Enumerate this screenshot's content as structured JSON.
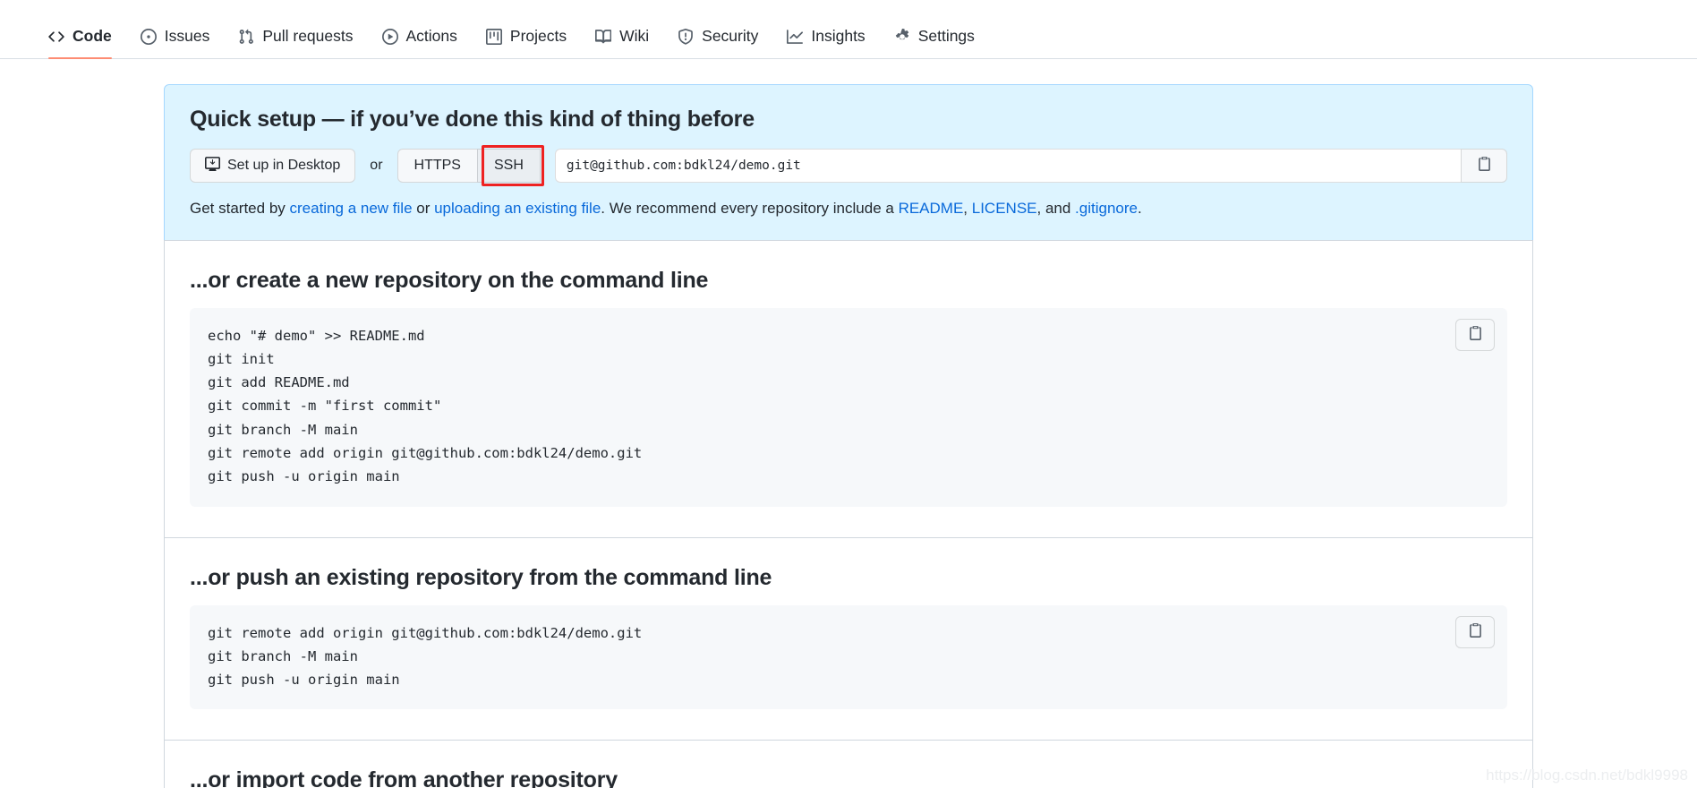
{
  "nav": {
    "items": [
      {
        "label": "Code",
        "icon": "code-icon",
        "active": true
      },
      {
        "label": "Issues",
        "icon": "issue-opened-icon",
        "active": false
      },
      {
        "label": "Pull requests",
        "icon": "git-pull-request-icon",
        "active": false
      },
      {
        "label": "Actions",
        "icon": "play-icon",
        "active": false
      },
      {
        "label": "Projects",
        "icon": "project-icon",
        "active": false
      },
      {
        "label": "Wiki",
        "icon": "book-icon",
        "active": false
      },
      {
        "label": "Security",
        "icon": "shield-icon",
        "active": false
      },
      {
        "label": "Insights",
        "icon": "graph-icon",
        "active": false
      },
      {
        "label": "Settings",
        "icon": "gear-icon",
        "active": false
      }
    ],
    "active_underline_color": "#fd8c73"
  },
  "quick_setup": {
    "title": "Quick setup — if you’ve done this kind of thing before",
    "desktop_button": "Set up in Desktop",
    "or_label": "or",
    "protocol": {
      "https_label": "HTTPS",
      "ssh_label": "SSH",
      "selected": "SSH",
      "highlight_color": "#ee2222"
    },
    "clone_url": "git@github.com:bdkl24/demo.git",
    "copy_icon": "clipboard-icon",
    "get_started": {
      "prefix": "Get started by ",
      "link_create": "creating a new file",
      "mid1": " or ",
      "link_upload": "uploading an existing file",
      "mid2": ". We recommend every repository include a ",
      "link_readme": "README",
      "comma1": ", ",
      "link_license": "LICENSE",
      "mid3": ", and ",
      "link_gitignore": ".gitignore",
      "suffix": "."
    },
    "background_color": "#ddf4ff"
  },
  "sections": [
    {
      "title": "...or create a new repository on the command line",
      "copy_icon": "clipboard-icon",
      "code": "echo \"# demo\" >> README.md\ngit init\ngit add README.md\ngit commit -m \"first commit\"\ngit branch -M main\ngit remote add origin git@github.com:bdkl24/demo.git\ngit push -u origin main"
    },
    {
      "title": "...or push an existing repository from the command line",
      "copy_icon": "clipboard-icon",
      "code": "git remote add origin git@github.com:bdkl24/demo.git\ngit branch -M main\ngit push -u origin main"
    }
  ],
  "last_section": {
    "title": "...or import code from another repository"
  },
  "watermark": "https://blog.csdn.net/bdkl9998"
}
